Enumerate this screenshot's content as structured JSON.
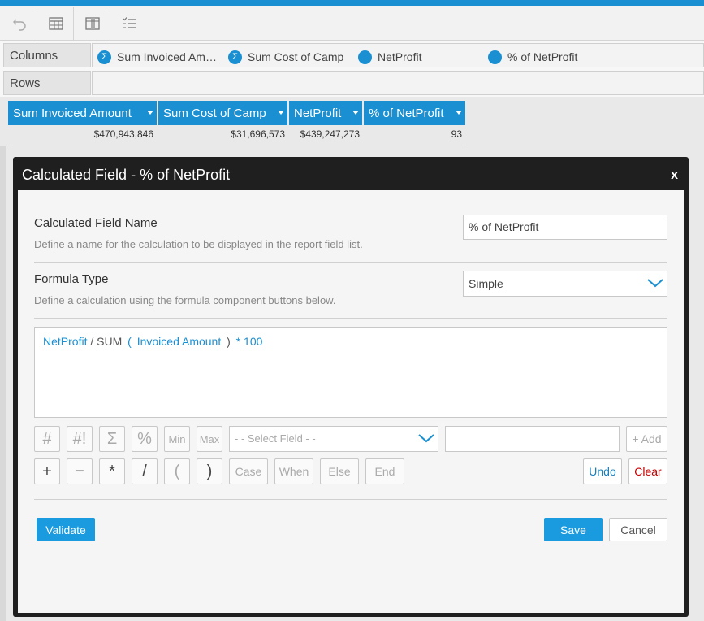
{
  "colors": {
    "accent": "#1a8fd1",
    "dialog_bar": "#1f1f1f",
    "clear_red": "#c00000"
  },
  "toolbar": {
    "icons": [
      "undo-icon",
      "table-icon",
      "columns-icon",
      "list-icon"
    ]
  },
  "columns_shelf": {
    "label": "Columns",
    "pills": [
      {
        "icon": "sum-icon",
        "text": "Sum Invoiced Am…"
      },
      {
        "icon": "sum-icon",
        "text": "Sum Cost of Camp"
      },
      {
        "icon": "calc-icon",
        "text": "NetProfit"
      },
      {
        "icon": "calc-icon",
        "text": "% of NetProfit"
      }
    ]
  },
  "rows_shelf": {
    "label": "Rows"
  },
  "grid": {
    "headers": [
      "Sum Invoiced Amount",
      "Sum Cost of Camp",
      "NetProfit",
      "% of NetProfit"
    ],
    "row": [
      "$470,943,846",
      "$31,696,573",
      "$439,247,273",
      "93"
    ]
  },
  "dialog": {
    "title": "Calculated Field - % of NetProfit",
    "close": "x",
    "name_section": {
      "title": "Calculated Field Name",
      "desc": "Define a name for the calculation to be displayed in the report field list.",
      "value": "% of NetProfit"
    },
    "type_section": {
      "title": "Formula Type",
      "desc": "Define a calculation using the formula component buttons below.",
      "value": "Simple"
    },
    "formula": {
      "t1": "NetProfit",
      "t2": "/",
      "t3": "SUM",
      "t4": "(",
      "t5": "Invoiced Amount",
      "t6": ")",
      "t7": "*",
      "t8": "100"
    },
    "buttons_row1": [
      "#",
      "#!",
      "Σ",
      "%",
      "Min",
      "Max"
    ],
    "select_field_placeholder": "- - Select Field - -",
    "add_label": "+ Add",
    "buttons_row2": [
      "+",
      "−",
      "*",
      "/",
      "(",
      ")"
    ],
    "buttons_row2_text": [
      "Case",
      "When",
      "Else",
      "End"
    ],
    "undo_label": "Undo",
    "clear_label": "Clear",
    "validate_label": "Validate",
    "save_label": "Save",
    "cancel_label": "Cancel"
  }
}
